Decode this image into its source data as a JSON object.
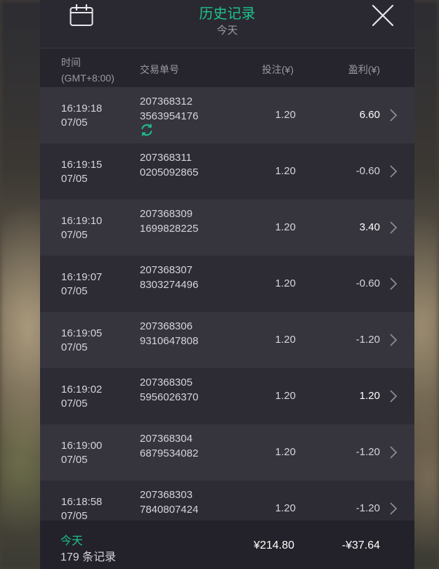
{
  "header": {
    "title": "历史记录",
    "subtitle": "今天",
    "calendar_icon": "calendar-icon",
    "close_icon": "close-icon"
  },
  "columns": {
    "time_line1": "时间",
    "time_line2": "(GMT+8:00)",
    "order_id": "交易单号",
    "stake": "投注(¥)",
    "profit": "盈利(¥)"
  },
  "rows": [
    {
      "time": "16:19:18",
      "date": "07/05",
      "id1": "207368312",
      "id2": "3563954176",
      "stake": "1.20",
      "profit": "6.60",
      "positive": true,
      "pending": true
    },
    {
      "time": "16:19:15",
      "date": "07/05",
      "id1": "207368311",
      "id2": "0205092865",
      "stake": "1.20",
      "profit": "-0.60",
      "positive": false,
      "pending": false
    },
    {
      "time": "16:19:10",
      "date": "07/05",
      "id1": "207368309",
      "id2": "1699828225",
      "stake": "1.20",
      "profit": "3.40",
      "positive": true,
      "pending": false
    },
    {
      "time": "16:19:07",
      "date": "07/05",
      "id1": "207368307",
      "id2": "8303274496",
      "stake": "1.20",
      "profit": "-0.60",
      "positive": false,
      "pending": false
    },
    {
      "time": "16:19:05",
      "date": "07/05",
      "id1": "207368306",
      "id2": "9310647808",
      "stake": "1.20",
      "profit": "-1.20",
      "positive": false,
      "pending": false
    },
    {
      "time": "16:19:02",
      "date": "07/05",
      "id1": "207368305",
      "id2": "5956026370",
      "stake": "1.20",
      "profit": "1.20",
      "positive": true,
      "pending": false
    },
    {
      "time": "16:19:00",
      "date": "07/05",
      "id1": "207368304",
      "id2": "6879534082",
      "stake": "1.20",
      "profit": "-1.20",
      "positive": false,
      "pending": false
    },
    {
      "time": "16:18:58",
      "date": "07/05",
      "id1": "207368303",
      "id2": "7840807424",
      "stake": "1.20",
      "profit": "-1.20",
      "positive": false,
      "pending": false
    }
  ],
  "footer": {
    "period": "今天",
    "count": "179 条记录",
    "total_stake": "¥214.80",
    "total_profit": "-¥37.64"
  },
  "colors": {
    "accent": "#1ec28b",
    "panel": "#2b2a33",
    "row_odd": "#36353e",
    "row_even": "#2d2c35"
  }
}
